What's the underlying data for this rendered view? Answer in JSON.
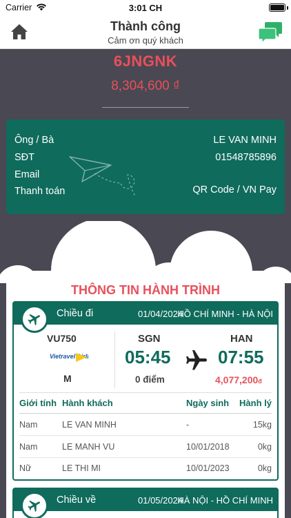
{
  "status_bar": {
    "carrier": "Carrier",
    "time": "3:01 CH"
  },
  "header": {
    "title": "Thành công",
    "subtitle": "Cảm ơn quý khách"
  },
  "booking": {
    "code": "6JNGNK",
    "amount": "8,304,600 ₫"
  },
  "contact": {
    "rows": [
      {
        "label": "Ông / Bà",
        "value": "LE VAN MINH"
      },
      {
        "label": "SĐT",
        "value": "01548785896"
      },
      {
        "label": "Email",
        "value": ""
      },
      {
        "label": "Thanh toán",
        "value": "QR Code / VN Pay"
      }
    ]
  },
  "itinerary": {
    "title": "THÔNG TIN HÀNH TRÌNH",
    "outbound": {
      "direction": "Chiều đi",
      "date": "01/04/2024",
      "route": "HỒ CHÍ MINH - HÀ NỘI",
      "flight_no": "VU750",
      "airline_logo": "Vietravel Airlines",
      "fare_class": "M",
      "dep_code": "SGN",
      "dep_time": "05:45",
      "arr_code": "HAN",
      "arr_time": "07:55",
      "points": "0 điểm",
      "price": "4,077,200",
      "currency": "đ",
      "columns": [
        "Giới tính",
        "Hành khách",
        "Ngày sinh",
        "Hành lý"
      ],
      "passengers": [
        {
          "gender": "Nam",
          "name": "LE VAN MINH",
          "dob": "-",
          "baggage": "15kg"
        },
        {
          "gender": "Nam",
          "name": "LE MANH VU",
          "dob": "10/01/2018",
          "baggage": "0kg"
        },
        {
          "gender": "Nữ",
          "name": "LE THI MI",
          "dob": "10/01/2023",
          "baggage": "0kg"
        }
      ]
    },
    "return": {
      "direction": "Chiều về",
      "date": "01/05/2024",
      "route": "HÀ NỘI - HỒ CHÍ MINH"
    }
  },
  "colors": {
    "accent": "#0f6b5c",
    "highlight": "#e8505b",
    "background": "#4a4852"
  }
}
